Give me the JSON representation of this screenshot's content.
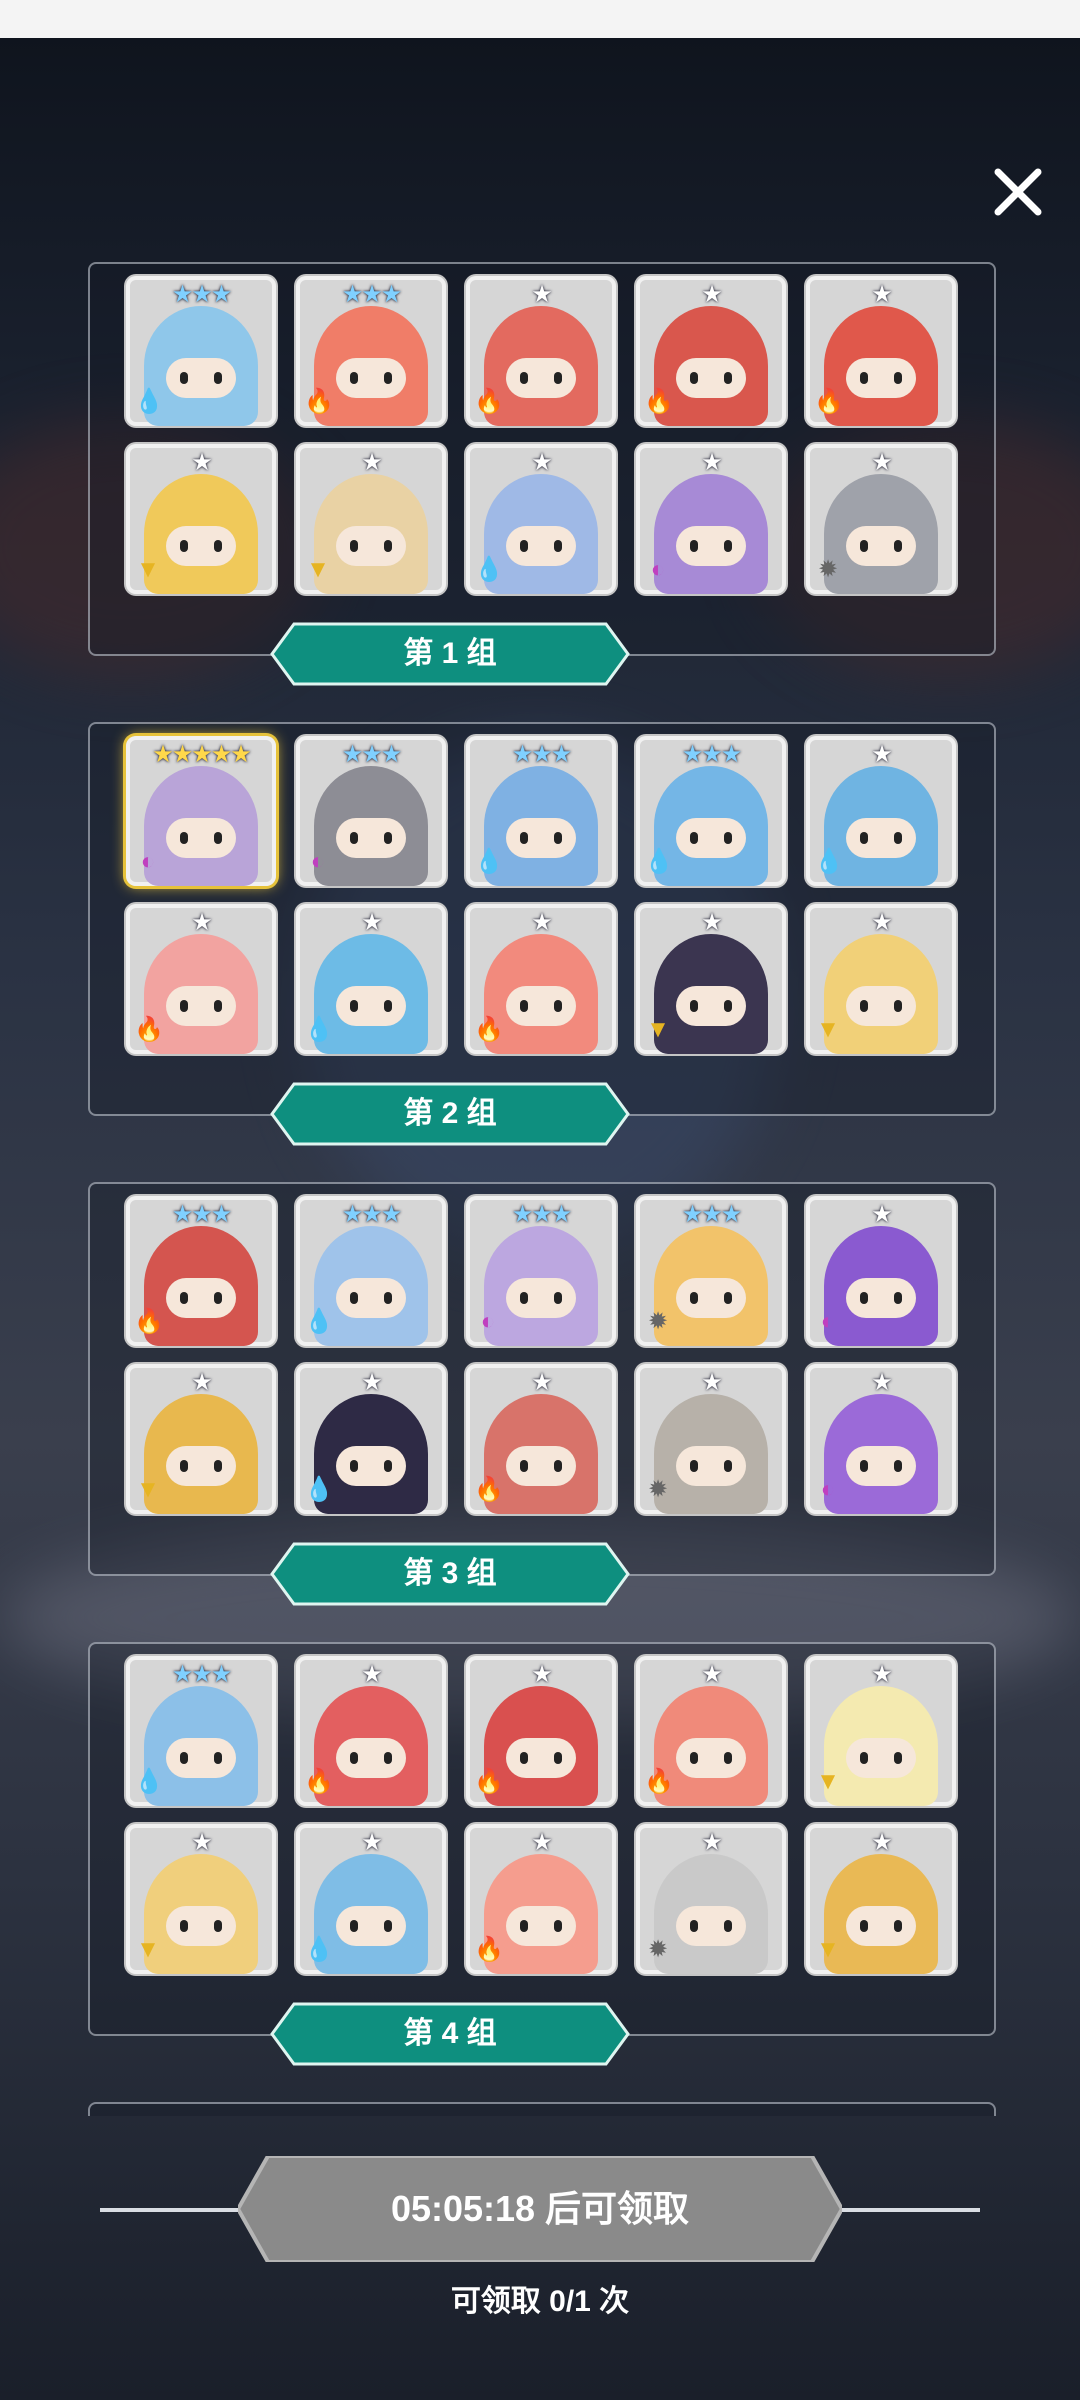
{
  "close_icon": "close-icon",
  "groups": [
    {
      "label": "第 1 组",
      "heroes": [
        {
          "stars": "★★★",
          "element": "water",
          "color": "#8fc7ea",
          "star_color": "#7fd0ff"
        },
        {
          "stars": "★★★",
          "element": "fire",
          "color": "#f07d68",
          "star_color": "#7fd0ff"
        },
        {
          "stars": "★",
          "element": "fire",
          "color": "#e36a5f",
          "star_color": "#ffffff"
        },
        {
          "stars": "★",
          "element": "fire",
          "color": "#d9574d",
          "star_color": "#ffffff"
        },
        {
          "stars": "★",
          "element": "fire",
          "color": "#e0584b",
          "star_color": "#ffffff"
        },
        {
          "stars": "★",
          "element": "earth",
          "color": "#f0c95a",
          "star_color": "#ffffff"
        },
        {
          "stars": "★",
          "element": "earth",
          "color": "#e9d2a4",
          "star_color": "#ffffff"
        },
        {
          "stars": "★",
          "element": "water",
          "color": "#9fb9e6",
          "star_color": "#ffffff"
        },
        {
          "stars": "★",
          "element": "dark",
          "color": "#a78ad6",
          "star_color": "#ffffff"
        },
        {
          "stars": "★",
          "element": "light",
          "color": "#9fa2aa",
          "star_color": "#ffffff"
        }
      ]
    },
    {
      "label": "第 2 组",
      "heroes": [
        {
          "stars": "★★★★★",
          "element": "dark",
          "color": "#b9a4d8",
          "star_color": "#ffd84a",
          "gold": true
        },
        {
          "stars": "★★★",
          "element": "dark",
          "color": "#8d8d95",
          "star_color": "#7fd0ff"
        },
        {
          "stars": "★★★",
          "element": "water",
          "color": "#7fb1e3",
          "star_color": "#7fd0ff"
        },
        {
          "stars": "★★★",
          "element": "water",
          "color": "#74b6e6",
          "star_color": "#7fd0ff"
        },
        {
          "stars": "★",
          "element": "water",
          "color": "#6fb4e2",
          "star_color": "#ffffff"
        },
        {
          "stars": "★",
          "element": "fire",
          "color": "#f2a3a0",
          "star_color": "#ffffff"
        },
        {
          "stars": "★",
          "element": "water",
          "color": "#6dbbe6",
          "star_color": "#ffffff"
        },
        {
          "stars": "★",
          "element": "fire",
          "color": "#f28a7d",
          "star_color": "#ffffff"
        },
        {
          "stars": "★",
          "element": "earth",
          "color": "#3b3550",
          "star_color": "#ffffff"
        },
        {
          "stars": "★",
          "element": "earth",
          "color": "#f1d078",
          "star_color": "#ffffff"
        }
      ]
    },
    {
      "label": "第 3 组",
      "heroes": [
        {
          "stars": "★★★",
          "element": "fire",
          "color": "#d4554f",
          "star_color": "#7fd0ff"
        },
        {
          "stars": "★★★",
          "element": "water",
          "color": "#9fc3ea",
          "star_color": "#7fd0ff"
        },
        {
          "stars": "★★★",
          "element": "dark",
          "color": "#bca7e0",
          "star_color": "#7fd0ff"
        },
        {
          "stars": "★★★",
          "element": "light",
          "color": "#f2c36a",
          "star_color": "#7fd0ff"
        },
        {
          "stars": "★",
          "element": "dark",
          "color": "#8a5ad0",
          "star_color": "#ffffff"
        },
        {
          "stars": "★",
          "element": "earth",
          "color": "#e8b84e",
          "star_color": "#ffffff"
        },
        {
          "stars": "★",
          "element": "water",
          "color": "#2e2a45",
          "star_color": "#ffffff"
        },
        {
          "stars": "★",
          "element": "fire",
          "color": "#d8736a",
          "star_color": "#ffffff"
        },
        {
          "stars": "★",
          "element": "light",
          "color": "#b7b1a9",
          "star_color": "#ffffff"
        },
        {
          "stars": "★",
          "element": "dark",
          "color": "#9b6ad8",
          "star_color": "#ffffff"
        }
      ]
    },
    {
      "label": "第 4 组",
      "heroes": [
        {
          "stars": "★★★",
          "element": "water",
          "color": "#8cc0e8",
          "star_color": "#7fd0ff"
        },
        {
          "stars": "★",
          "element": "fire",
          "color": "#e35f60",
          "star_color": "#ffffff"
        },
        {
          "stars": "★",
          "element": "fire",
          "color": "#d9504f",
          "star_color": "#ffffff"
        },
        {
          "stars": "★",
          "element": "fire",
          "color": "#f08a7a",
          "star_color": "#ffffff"
        },
        {
          "stars": "★",
          "element": "earth",
          "color": "#f4eab0",
          "star_color": "#ffffff"
        },
        {
          "stars": "★",
          "element": "earth",
          "color": "#f0cf7c",
          "star_color": "#ffffff"
        },
        {
          "stars": "★",
          "element": "water",
          "color": "#7fbde6",
          "star_color": "#ffffff"
        },
        {
          "stars": "★",
          "element": "fire",
          "color": "#f59d8e",
          "star_color": "#ffffff"
        },
        {
          "stars": "★",
          "element": "light",
          "color": "#c9c9c9",
          "star_color": "#ffffff"
        },
        {
          "stars": "★",
          "element": "earth",
          "color": "#e9b955",
          "star_color": "#ffffff"
        }
      ]
    }
  ],
  "element_icons": {
    "water": {
      "glyph": "💧",
      "color": "#2d7fd8"
    },
    "fire": {
      "glyph": "🔥",
      "color": "#e24a2a"
    },
    "earth": {
      "glyph": "▼",
      "color": "#e6b422"
    },
    "dark": {
      "glyph": "◐",
      "color": "#c03fbf"
    },
    "light": {
      "glyph": "✹",
      "color": "#666666"
    }
  },
  "claim": {
    "button_label": "05:05:18 后可领取",
    "count_text": "可领取 0/1 次"
  }
}
